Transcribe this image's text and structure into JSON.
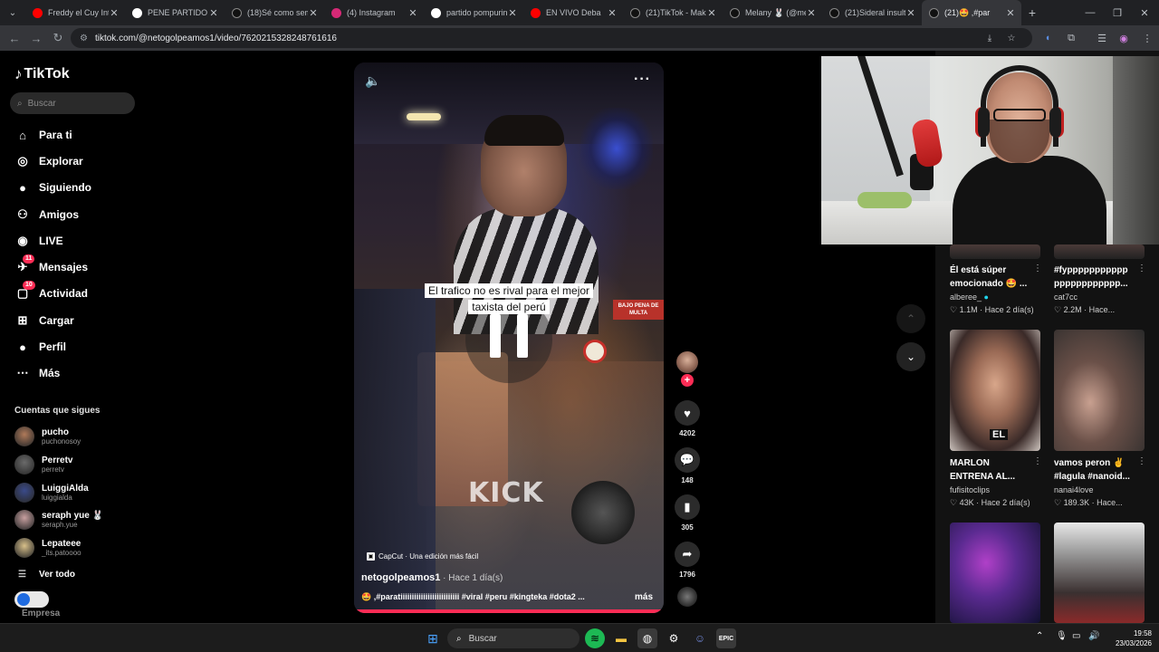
{
  "browser": {
    "tabs": [
      {
        "title": "Freddy el Cuy Inte",
        "icon": "youtube-icon",
        "color": "#ff0000"
      },
      {
        "title": "PENE PARTIDO - ",
        "icon": "google-icon",
        "color": "#ffffff"
      },
      {
        "title": "(18)Sé como sem",
        "icon": "tiktok-icon",
        "color": "#111111"
      },
      {
        "title": "(4) Instagram",
        "icon": "instagram-icon",
        "color": "#d62976"
      },
      {
        "title": "partido pompurin",
        "icon": "google-icon",
        "color": "#ffffff"
      },
      {
        "title": "EN VIVO Deba",
        "icon": "youtube-icon",
        "color": "#ff0000"
      },
      {
        "title": "(21)TikTok - Make",
        "icon": "tiktok-icon",
        "color": "#111111"
      },
      {
        "title": "Melany 🐰 (@me",
        "icon": "tiktok-icon",
        "color": "#111111"
      },
      {
        "title": "(21)Sideral insult",
        "icon": "tiktok-icon",
        "color": "#111111"
      },
      {
        "title": "(21)🤩 ,#par",
        "icon": "tiktok-icon",
        "color": "#111111",
        "active": true
      }
    ],
    "url": "tiktok.com/@netogolpeamos1/video/7620215328248761616"
  },
  "sidebar": {
    "logo": "TikTok",
    "search_placeholder": "Buscar",
    "nav": [
      {
        "label": "Para ti",
        "icon": "home-icon"
      },
      {
        "label": "Explorar",
        "icon": "compass-icon"
      },
      {
        "label": "Siguiendo",
        "icon": "following-avatar-icon"
      },
      {
        "label": "Amigos",
        "icon": "friends-icon"
      },
      {
        "label": "LIVE",
        "icon": "live-icon"
      },
      {
        "label": "Mensajes",
        "icon": "messages-icon",
        "badge": "11"
      },
      {
        "label": "Actividad",
        "icon": "activity-icon",
        "badge": "10"
      },
      {
        "label": "Cargar",
        "icon": "upload-icon"
      },
      {
        "label": "Perfil",
        "icon": "profile-icon"
      },
      {
        "label": "Más",
        "icon": "more-icon"
      }
    ],
    "following_title": "Cuentas que sigues",
    "following": [
      {
        "name": "pucho",
        "handle": "puchonosoy",
        "color": "#b07a5a"
      },
      {
        "name": "Perretv",
        "handle": "perretv",
        "color": "#6a6a6a"
      },
      {
        "name": "LuiggiAlda",
        "handle": "luiggialda",
        "color": "#3a4a8a"
      },
      {
        "name": "seraph yue 🐰",
        "handle": "seraph.yue",
        "color": "#c8a0a0"
      },
      {
        "name": "Lepateee",
        "handle": "_its.patoooo",
        "color": "#d8c08a"
      }
    ],
    "see_all": "Ver todo",
    "business": "Empresa"
  },
  "video": {
    "caption_line1": "El trafico no es rival para el mejor",
    "caption_line2": "taxista del perú",
    "watermark": "KICK",
    "sign_text": "BAJO PENA DE MULTA",
    "capcut": "CapCut · Una edición más fácil",
    "author": "netogolpeamos1",
    "posted": " · Hace 1 día(s)",
    "description": "🤩 ,#paratiiiiiiiiiiiiiiiiiiiiiiiiii #viral #peru #kingteka #dota2 ...",
    "more": "más",
    "progress": 0.99
  },
  "actions": {
    "likes": "4202",
    "comments": "148",
    "saves": "305",
    "shares": "1796"
  },
  "recommended": [
    {
      "title_l1": "Él está súper",
      "title_l2": "emocionado 🤩 ...",
      "user": "alberee_",
      "verified": true,
      "likes": "1.1M",
      "ago": "Hace 2 día(s)"
    },
    {
      "title_l1": "#fyppppppppppp",
      "title_l2": "pppppppppppp...",
      "user": "cat7cc",
      "verified": false,
      "likes": "2.2M",
      "ago": "Hace..."
    },
    {
      "title_l1": "MARLON",
      "title_l2": "ENTRENA AL...",
      "user": "fufisitoclips",
      "verified": false,
      "likes": "43K",
      "ago": "Hace 2 día(s)",
      "thumb_text": "EL"
    },
    {
      "title_l1": "vamos peron ✌️",
      "title_l2": "#lagula #nanoid...",
      "user": "nanai4love",
      "verified": false,
      "likes": "189.3K",
      "ago": "Hace..."
    }
  ],
  "taskbar": {
    "search": "Buscar",
    "time": "19:58",
    "date": "23/03/2026"
  }
}
